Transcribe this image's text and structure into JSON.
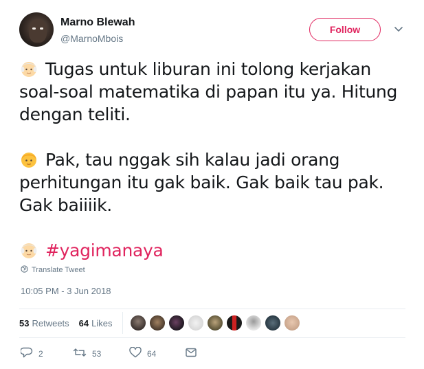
{
  "user": {
    "name": "Marno Blewah",
    "handle": "@MarnoMbois",
    "follow_label": "Follow"
  },
  "tweet": {
    "lines": [
      {
        "emoji": "old-man-emoji",
        "text": "Tugas untuk liburan ini tolong kerjakan soal-soal matematika di papan itu ya. Hitung dengan teliti."
      },
      {
        "emoji": "boy-emoji",
        "text": "Pak, tau nggak sih kalau jadi orang perhitungan itu gak baik. Gak baik tau pak. Gak baiiiik."
      },
      {
        "emoji": "old-man-emoji",
        "hashtag": "#yagimanaya"
      }
    ],
    "translate_label": "Translate Tweet",
    "timestamp": "10:05 PM - 3 Jun 2018"
  },
  "stats": {
    "retweets_count": "53",
    "retweets_label": "Retweets",
    "likes_count": "64",
    "likes_label": "Likes"
  },
  "actions": {
    "reply_count": "2",
    "retweet_count": "53",
    "like_count": "64"
  },
  "colors": {
    "accent": "#e0245e",
    "muted": "#657786",
    "text": "#14171a",
    "border": "#e6ecf0"
  }
}
